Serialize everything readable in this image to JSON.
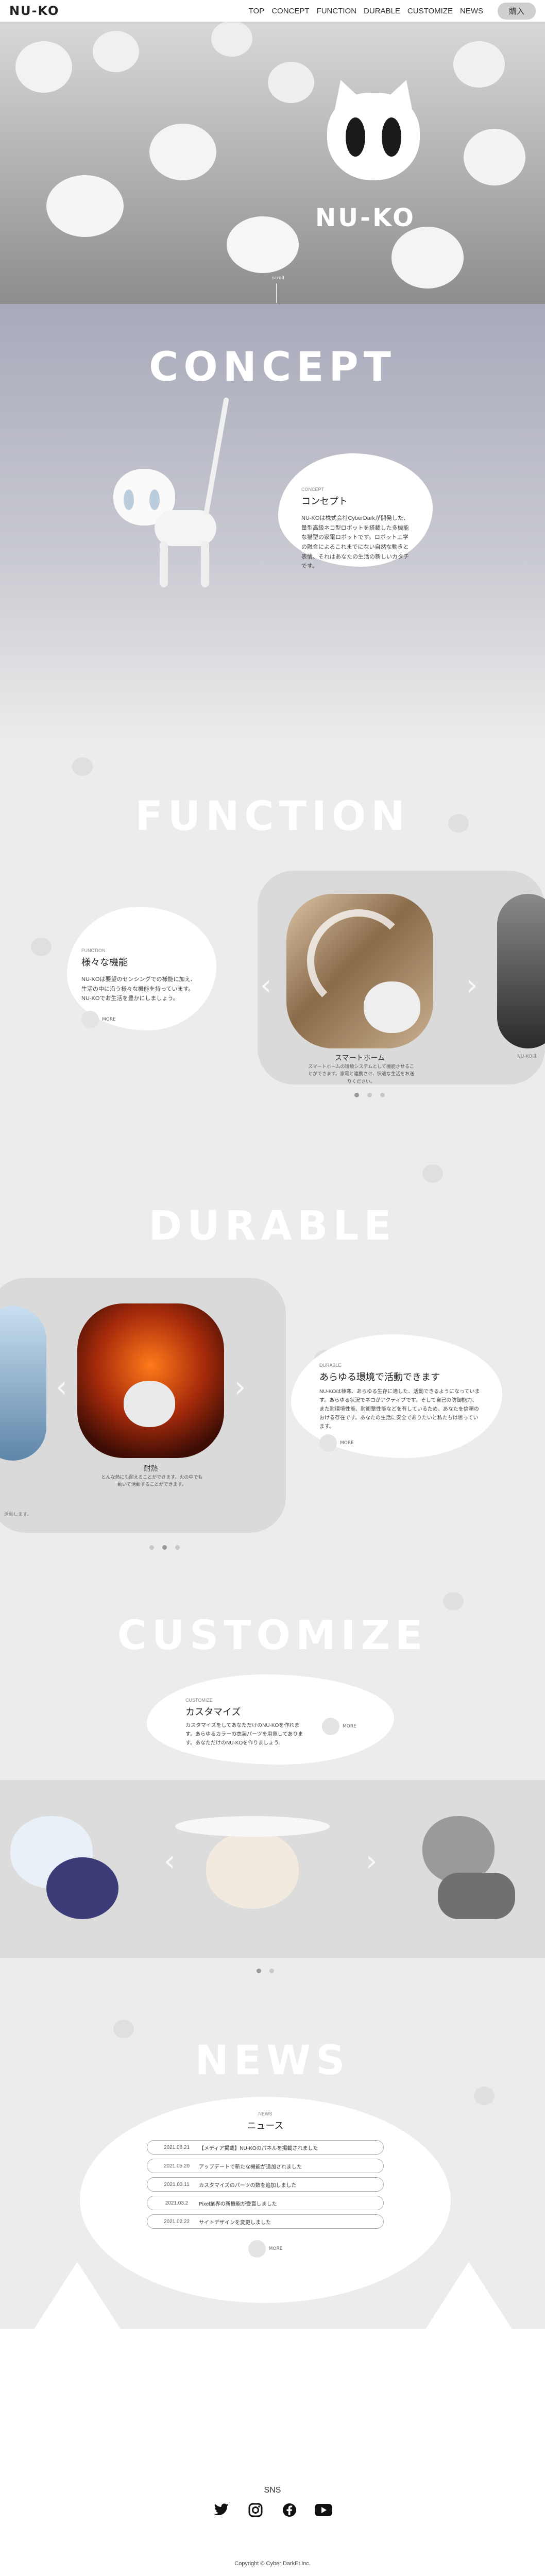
{
  "header": {
    "logo": "NU-KO",
    "nav": [
      "TOP",
      "CONCEPT",
      "FUNCTION",
      "DURABLE",
      "CUSTOMIZE",
      "NEWS"
    ],
    "buy_label": "購入"
  },
  "hero": {
    "logo": "NU-KO",
    "scroll": "scroll"
  },
  "concept": {
    "title": "CONCEPT",
    "small": "CONCEPT",
    "heading": "コンセプト",
    "body": "NU-KOは株式会社CyberDarkが開発した、量型高級ネコ型ロボットを搭載した多機能な猫型の家電ロボットです。ロボット工学の融合によるこれまでにない自然な動きと表情、それはあなたの生活の新しいカタチです。"
  },
  "function": {
    "title": "FUNCTION",
    "small": "FUNCTION",
    "heading": "様々な機能",
    "body": "NU-KOは要望のセンシングでの様能に加え、生活の中に沿う様々な機能を持っています。NU-KOでお生活を豊かにしましょう。",
    "more": "MORE",
    "slide_title": "スマートホーム",
    "slide_caption": "スマートホームの環境システムとして機能させることができます。家電と連携させ、快適な生活をお送りください。",
    "right_caption": "NU-KOは"
  },
  "durable": {
    "title": "DURABLE",
    "small": "DURABLE",
    "heading": "あらゆる環境で活動できます",
    "body": "NU-KOは極寒、あらゆる生存に適した、活動できるようになっています。あらゆる状況でネコがアクティブです。そして自己の防御能力、また耐環境性能、耐衝撃性能などを有しているため、あなたを信頼のおける存在です。あなたの生活に安全でありたいと私たちは思っています。",
    "more": "MORE",
    "slide_title": "耐熱",
    "slide_caption": "とんな熱にも耐えることができます。火の中でも動いて活動することができます。",
    "left_caption": "活動します。"
  },
  "customize": {
    "title": "CUSTOMIZE",
    "small": "CUSTOMIZE",
    "heading": "カスタマイズ",
    "body": "カスタマイズをしてあなただけのNU-KOを作れます。あらゆるカラーの衣装パーツを用意してあります。あなただけのNU-KOを作りましょう。",
    "more": "MORE"
  },
  "news": {
    "title": "NEWS",
    "small": "NEWS",
    "heading": "ニュース",
    "items": [
      {
        "date": "2021.08.21",
        "text": "【メディア掲載】NU-KOのパネルを掲載されました"
      },
      {
        "date": "2021.05.20",
        "text": "アップデートで新たな機能が追加されました"
      },
      {
        "date": "2021.03.11",
        "text": "カスタマイズのパーツの数を追加しました"
      },
      {
        "date": "2021.03.2",
        "text": "Pixel業界の新機能が受賞しました"
      },
      {
        "date": "2021.02.22",
        "text": "サイトデザインを変更しました"
      }
    ],
    "more": "MORE"
  },
  "footer": {
    "sns_title": "SNS",
    "copyright": "Copyright © Cyber DarkEt.inc."
  }
}
